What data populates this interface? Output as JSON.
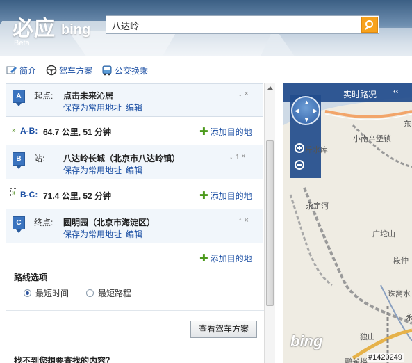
{
  "header": {
    "logo_cn": "必应",
    "logo_bing": "bing",
    "logo_beta": "Beta",
    "search_value": "八达岭",
    "search_icon": "magnifier-icon"
  },
  "toolbar": {
    "intro": "简介",
    "driving": "驾车方案",
    "transit": "公交换乘"
  },
  "route": {
    "stops": [
      {
        "marker": "A",
        "label": "起点:",
        "name": "点击未来沁居",
        "save": "保存为常用地址",
        "edit": "编辑",
        "controls": "↓ ×"
      },
      {
        "marker": "B",
        "label": "站:",
        "name": "八达岭长城（北京市八达岭镇）",
        "save": "保存为常用地址",
        "edit": "编辑",
        "controls": "↓ ↑ ×"
      },
      {
        "marker": "C",
        "label": "终点:",
        "name": "圆明园（北京市海淀区）",
        "save": "保存为常用地址",
        "edit": "编辑",
        "controls": "↑ ×"
      }
    ],
    "legs": [
      {
        "code": "A-B:",
        "info": "64.7 公里, 51 分钟"
      },
      {
        "code": "B-C:",
        "info": "71.4 公里, 52 分钟"
      }
    ],
    "add_destination": "添加目的地"
  },
  "options": {
    "title": "路线选项",
    "shortest_time": "最短时间",
    "shortest_distance": "最短路程",
    "selected": "shortest_time"
  },
  "actions": {
    "view_plan": "查看驾车方案"
  },
  "feedback": "找不到您想要查找的内容？",
  "map": {
    "traffic_label": "实时路况",
    "collapse": "‹‹",
    "labels": {
      "reservoir": "斤水库",
      "xiaonan": "小南辛堡镇",
      "dong": "东",
      "yongding": "永定河",
      "guangba": "广坨山",
      "duanjia": "段仲",
      "zhuwo": "珠窝水",
      "dushan": "独山",
      "yongbottom": "永",
      "quarry": "鹦雀楼"
    },
    "watermark": "bing",
    "image_id": "#1420249"
  }
}
